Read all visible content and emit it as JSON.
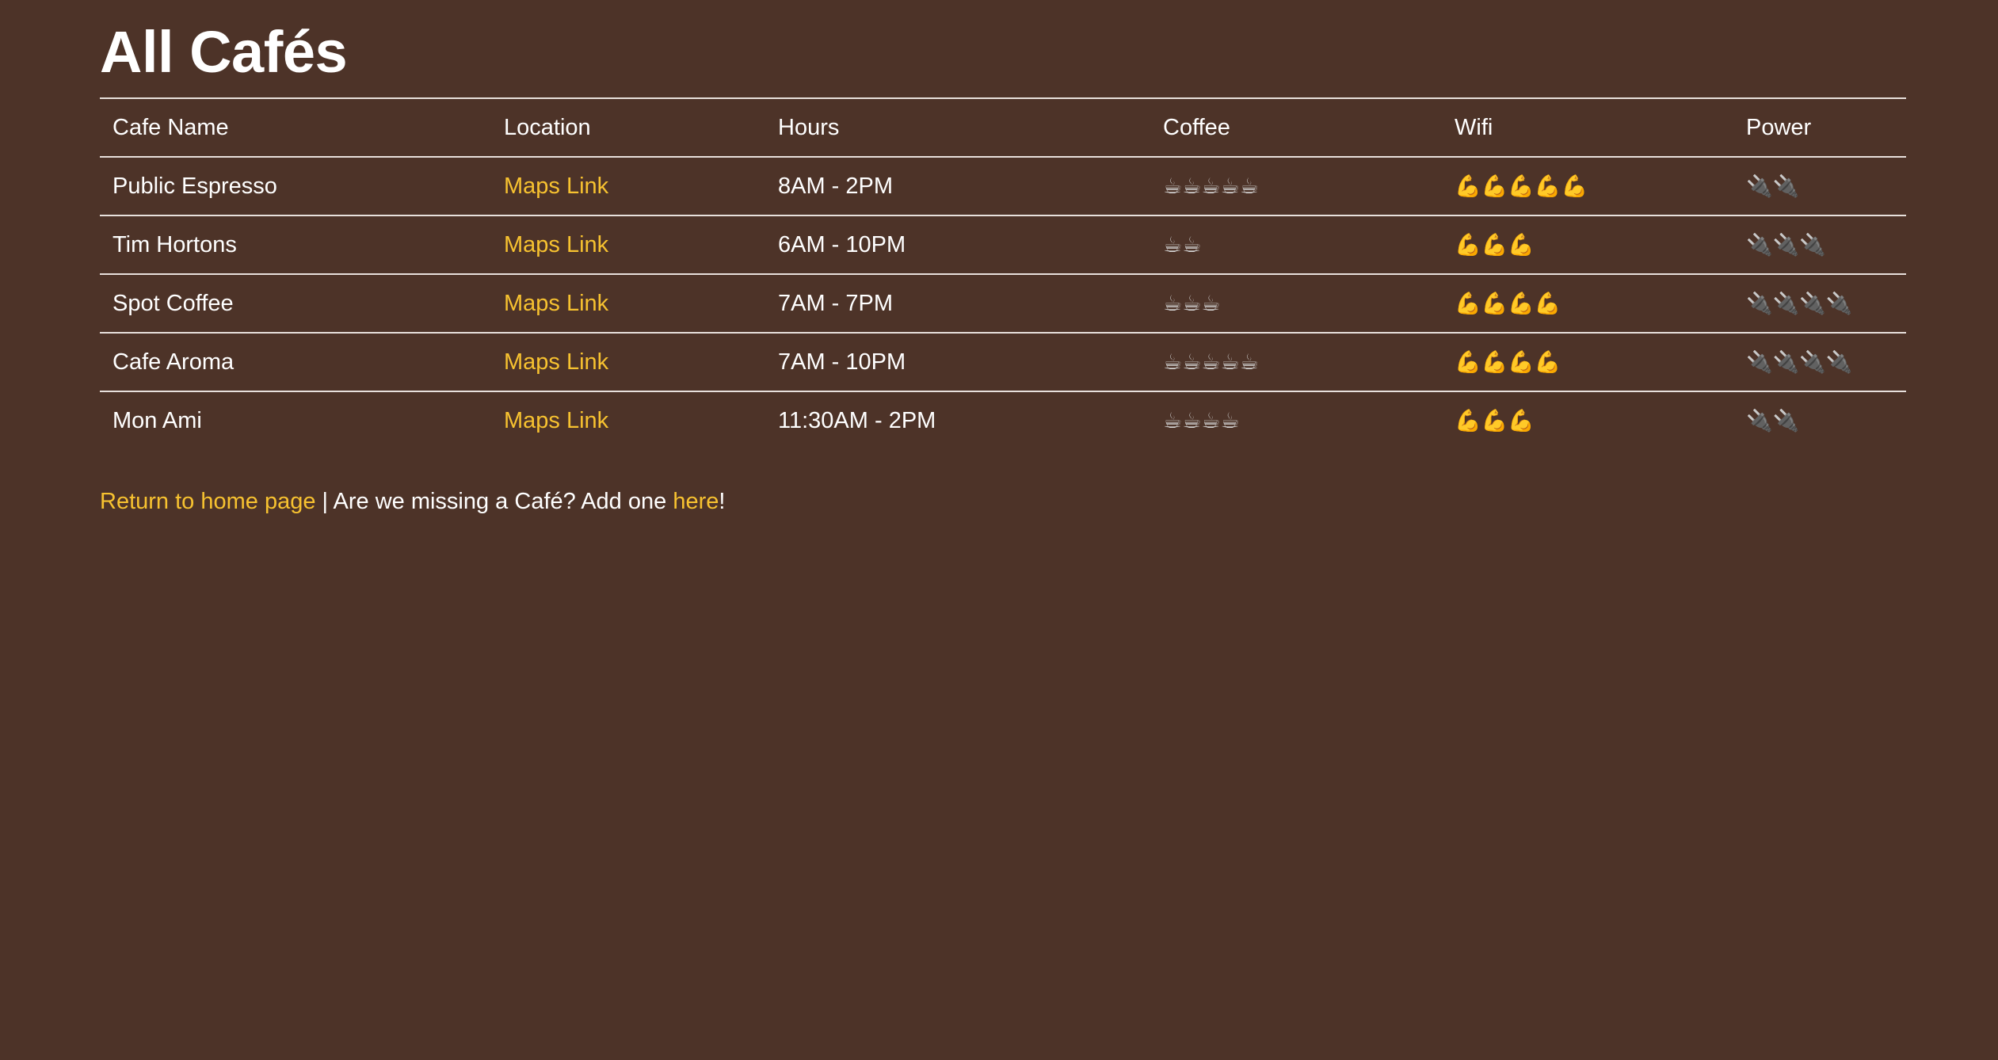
{
  "page": {
    "title": "All Cafés"
  },
  "table": {
    "headers": [
      "Cafe Name",
      "Location",
      "Hours",
      "Coffee",
      "Wifi",
      "Power"
    ],
    "rows": [
      {
        "name": "Public Espresso",
        "location": "Maps Link",
        "hours": "8AM - 2PM",
        "coffee": "☕☕☕☕☕",
        "wifi": "💪💪💪💪💪",
        "power": "🔌🔌"
      },
      {
        "name": "Tim Hortons",
        "location": "Maps Link",
        "hours": "6AM - 10PM",
        "coffee": "☕☕",
        "wifi": "💪💪💪",
        "power": "🔌🔌🔌"
      },
      {
        "name": "Spot Coffee",
        "location": "Maps Link",
        "hours": "7AM - 7PM",
        "coffee": "☕☕☕",
        "wifi": "💪💪💪💪",
        "power": "🔌🔌🔌🔌"
      },
      {
        "name": "Cafe Aroma",
        "location": "Maps Link",
        "hours": "7AM - 10PM",
        "coffee": "☕☕☕☕☕",
        "wifi": "💪💪💪💪",
        "power": "🔌🔌🔌🔌"
      },
      {
        "name": "Mon Ami",
        "location": "Maps Link",
        "hours": "11:30AM - 2PM",
        "coffee": "☕☕☕☕",
        "wifi": "💪💪💪",
        "power": "🔌🔌"
      }
    ]
  },
  "footer": {
    "home_link": "Return to home page",
    "separator_text": " | Are we missing a Café? Add one ",
    "add_link": "here",
    "end_text": "!"
  },
  "colors": {
    "background": "#4d3328",
    "text": "#ffffff",
    "link": "#f7c230",
    "rule": "#e8e0dc"
  },
  "icons": {
    "coffee": "coffee-cup-icon",
    "wifi": "flexed-biceps-icon",
    "power": "electric-plug-icon"
  }
}
